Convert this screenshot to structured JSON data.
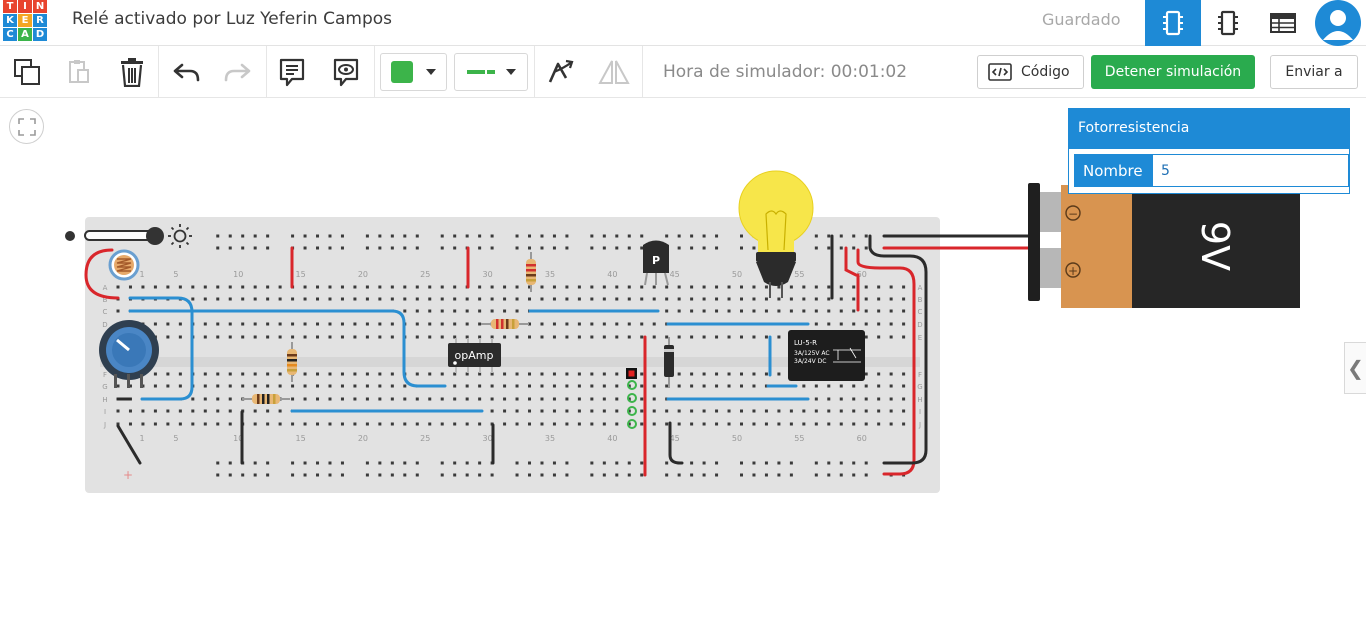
{
  "header": {
    "logo_letters": [
      "T",
      "I",
      "N",
      "K",
      "E",
      "R",
      "C",
      "A",
      "D"
    ],
    "logo_colors": [
      "#e8442e",
      "#e8442e",
      "#e8442e",
      "#1e8ad6",
      "#f4a623",
      "#1e8ad6",
      "#1e8ad6",
      "#3bb44a",
      "#1e8ad6"
    ],
    "title": "Relé activado por Luz Yeferin Campos",
    "save_status": "Guardado",
    "view_icons": [
      "circuit-view-icon",
      "schematic-view-icon",
      "component-list-icon"
    ],
    "avatar_icon": "user-avatar-icon"
  },
  "toolbar": {
    "icons": [
      "copy-icon",
      "paste-icon",
      "delete-icon",
      "undo-icon",
      "redo-icon",
      "note-icon",
      "notes-visibility-icon",
      "wire-color-icon",
      "wire-style-icon",
      "rotate-icon",
      "flip-icon"
    ],
    "wire_color": "#3cb44a",
    "simulator_time_label": "Hora de simulador: 00:01:02",
    "code_label": "Código",
    "stop_label": "Detener simulación",
    "send_label": "Enviar a"
  },
  "inspector": {
    "title": "Fotorresistencia",
    "field_label": "Nombre",
    "field_value": "5"
  },
  "breadboard": {
    "top_numbers": [
      "1",
      "5",
      "10",
      "15",
      "20",
      "25",
      "30",
      "35",
      "40",
      "45",
      "50",
      "55",
      "60"
    ],
    "bottom_numbers": [
      "1",
      "5",
      "10",
      "15",
      "20",
      "25",
      "30",
      "35",
      "40",
      "45",
      "50",
      "55",
      "60"
    ],
    "row_letters_left": [
      "A",
      "B",
      "C",
      "D",
      "E",
      "F",
      "G",
      "H",
      "I",
      "J"
    ],
    "row_letters_right": [
      "A",
      "B",
      "C",
      "D",
      "E",
      "F",
      "G",
      "H",
      "I",
      "J"
    ],
    "plus_label": "+"
  },
  "components": {
    "opamp_label": "opAmp",
    "transistor_label": "P",
    "relay_title": "LU-5-R",
    "relay_line1": "3A/125V AC",
    "relay_line2": "3A/24V  DC",
    "battery_label": "9V",
    "battery_minus": "−",
    "battery_plus": "+"
  },
  "colors": {
    "accent": "#1e8ad6",
    "stop_button": "#2aab4e",
    "wire_red": "#d9262b",
    "wire_blue": "#2b8fd1",
    "wire_black": "#2b2b2b",
    "breadboard": "#e2e2e2",
    "bulb": "#f7e64a"
  }
}
